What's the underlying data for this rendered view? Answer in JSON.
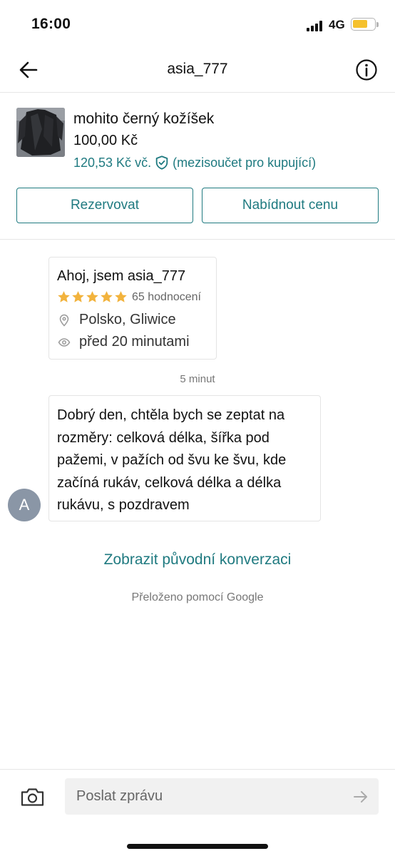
{
  "status_bar": {
    "time": "16:00",
    "network": "4G",
    "signal_icon": "signal-bars-icon",
    "battery_icon": "battery-icon",
    "battery_color": "#f5c12e"
  },
  "nav": {
    "title": "asia_777",
    "back_icon": "arrow-left-icon",
    "info_icon": "info-icon"
  },
  "item": {
    "title": "mohito černý kožíšek",
    "price": "100,00 Kč",
    "buyer_price": "120,53 Kč vč.",
    "buyer_note": "(mezisoučet pro kupující)",
    "protection_icon": "shield-check-icon",
    "reserve_label": "Rezervovat",
    "offer_label": "Nabídnout cenu"
  },
  "seller": {
    "greeting": "Ahoj, jsem asia_777",
    "rating_stars": 5,
    "rating_count": "65 hodnocení",
    "location": "Polsko, Gliwice",
    "last_seen": "před 20 minutami"
  },
  "timestamp": "5 minut",
  "message": {
    "avatar_letter": "A",
    "text": "Dobrý den, chtěla bych se zeptat na rozměry: celková délka, šířka pod pažemi, v pažích od švu ke švu, kde začíná rukáv, celková délka a délka rukávu, s pozdravem"
  },
  "show_original_label": "Zobrazit původní konverzaci",
  "translated_label": "Přeloženo pomocí Google",
  "composer": {
    "placeholder": "Poslat zprávu",
    "value": "",
    "camera_icon": "camera-icon",
    "send_icon": "send-arrow-icon"
  },
  "colors": {
    "accent": "#1f7a80",
    "star": "#f2b33d"
  }
}
